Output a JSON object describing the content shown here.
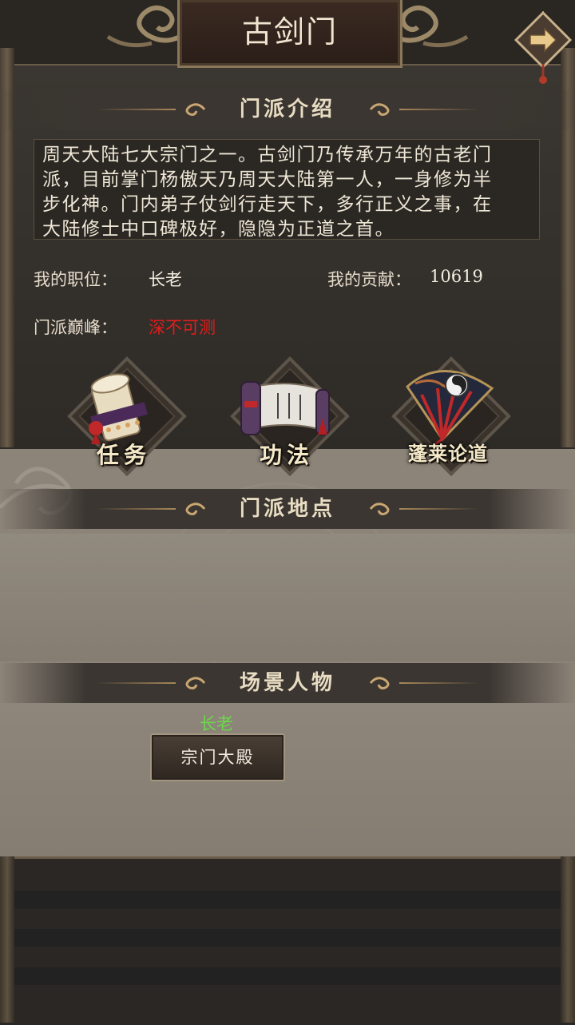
{
  "header": {
    "title": "古剑门"
  },
  "sections": {
    "intro_header": "门派介绍",
    "location_header": "门派地点",
    "npc_header": "场景人物"
  },
  "intro": {
    "line1": "周天大陆七大宗门之一。古剑门乃传承万年的古老门",
    "line2": "派，目前掌门杨傲天乃周天大陆第一人，一身修为半",
    "line3": "步化神。门内弟子仗剑行走天下，多行正义之事，在",
    "line4": "大陆修士中口碑极好，隐隐为正道之首。"
  },
  "stats": {
    "position_label": "我的职位：",
    "position_value": "长老",
    "contribution_label": "我的贡献：",
    "contribution_value": "10619",
    "peak_label": "门派巅峰：",
    "peak_value": "深不可测"
  },
  "actions": [
    {
      "label": "任务",
      "icon": "scroll-bundle-icon"
    },
    {
      "label": "功法",
      "icon": "open-scroll-icon"
    },
    {
      "label": "蓬莱论道",
      "icon": "fan-icon"
    }
  ],
  "npc": {
    "title": "长老",
    "location_button": "宗门大殿"
  },
  "colors": {
    "accent_gold": "#a8875a",
    "peak_red": "#e31c1c",
    "npc_green": "#6bd84a"
  }
}
